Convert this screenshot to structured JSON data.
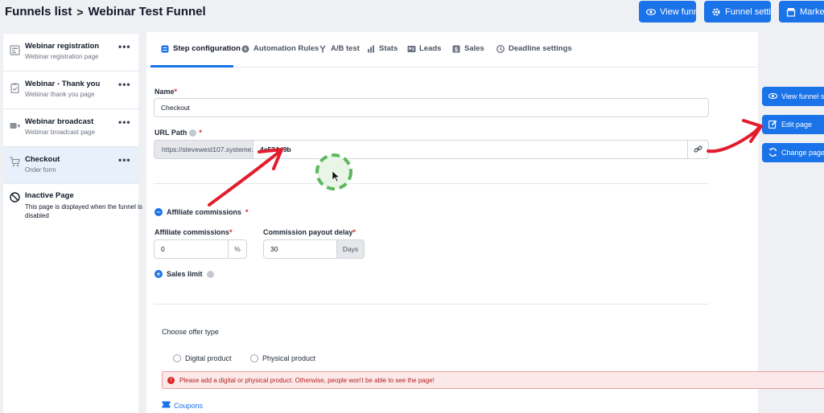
{
  "header": {
    "breadcrumb_root": "Funnels list",
    "breadcrumb_sep": ">",
    "breadcrumb_current": "Webinar Test Funnel",
    "buttons": {
      "view_funnel": "View funnel",
      "funnel_settings": "Funnel settings",
      "marketplace": "Marketpl"
    }
  },
  "sidebar": {
    "items": [
      {
        "title": "Webinar registration",
        "subtitle": "Webinar registration page",
        "icon": "page-icon"
      },
      {
        "title": "Webinar - Thank you",
        "subtitle": "Webinar thank you page",
        "icon": "clipboard-icon"
      },
      {
        "title": "Webinar broadcast",
        "subtitle": "Webinar broadcast page",
        "icon": "video-icon"
      },
      {
        "title": "Checkout",
        "subtitle": "Order form",
        "icon": "cart-icon"
      }
    ],
    "inactive": {
      "title": "Inactive Page",
      "subtitle_line1": "This page is displayed when the funnel is",
      "subtitle_line2": "disabled",
      "icon": "disabled-icon"
    },
    "more_label": "•••"
  },
  "tabs": [
    {
      "label": "Step configuration",
      "icon": "settings-icon"
    },
    {
      "label": "Automation Rules",
      "icon": "bolt-icon"
    },
    {
      "label": "A/B test",
      "icon": "split-icon"
    },
    {
      "label": "Stats",
      "icon": "bar-chart-icon"
    },
    {
      "label": "Leads",
      "icon": "users-icon"
    },
    {
      "label": "Sales",
      "icon": "dollar-icon"
    },
    {
      "label": "Deadline settings",
      "icon": "clock-icon"
    }
  ],
  "form": {
    "name_label": "Name",
    "required_mark": "*",
    "name_value": "Checkout",
    "url_label": "URL Path",
    "url_prefix": "https://stevewest107.systeme.io/",
    "url_value": "4e524d9b",
    "affiliate_toggle_label": "Affiliate commissions",
    "affiliate_commissions_label": "Affiliate commissions",
    "affiliate_value": "0",
    "affiliate_unit": "%",
    "payout_delay_label": "Commission payout delay",
    "payout_delay_value": "30",
    "payout_delay_unit": "Days",
    "sales_limit_label": "Sales limit",
    "offer_type_label": "Choose offer type",
    "digital_label": "Digital product",
    "physical_label": "Physical product",
    "alert_text": "Please add a digital or physical product. Otherwise, people won't be able to see the page!",
    "coupons_label": "Coupons"
  },
  "right_actions": {
    "view_funnel_step": "View funnel step",
    "edit_page": "Edit page",
    "change_page_template": "Change page te"
  },
  "colors": {
    "accent": "#1a73e8",
    "annotation_red": "#e11d2e",
    "cursor_ring": "#5cb85c"
  }
}
